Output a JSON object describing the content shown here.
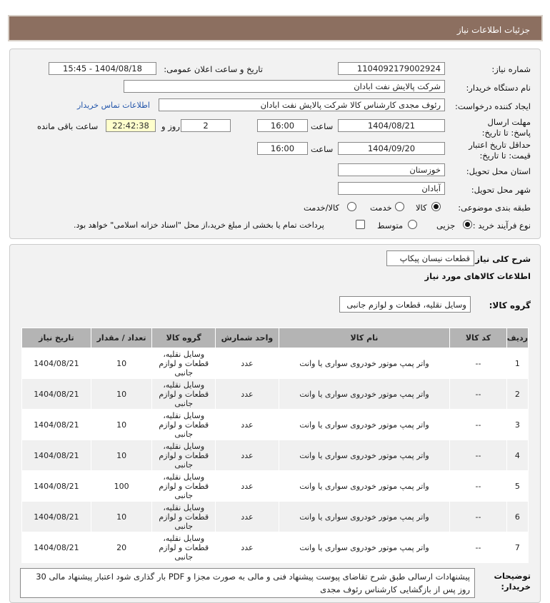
{
  "header": {
    "title": "جزئیات اطلاعات نیاز"
  },
  "form": {
    "need_number_label": "شماره نیاز:",
    "need_number": "1104092179002924",
    "announce_label": "تاریخ و ساعت اعلان عمومی:",
    "announce_value": "1404/08/18 - 15:45",
    "buyer_org_label": "نام دستگاه خریدار:",
    "buyer_org": "شرکت پالایش نفت ابادان",
    "creator_label": "ایجاد کننده درخواست:",
    "creator": "رئوف مجدی کارشناس کالا شرکت پالایش نفت ابادان",
    "contact_link": "اطلاعات تماس خریدار",
    "deadline_label": "مهلت ارسال پاسخ: تا تاریخ:",
    "deadline_date": "1404/08/21",
    "time_label": "ساعت",
    "deadline_time": "16:00",
    "days_value": "2",
    "days_label": "روز و",
    "remaining_time": "22:42:38",
    "remaining_label": "ساعت باقی مانده",
    "validity_label": "حداقل تاریخ اعتبار قیمت: تا تاریخ:",
    "validity_date": "1404/09/20",
    "validity_time": "16:00",
    "province_label": "استان محل تحویل:",
    "province": "خوزستان",
    "city_label": "شهر محل تحویل:",
    "city": "آبادان",
    "category_label": "طبقه بندی موضوعی:",
    "category_options": [
      "کالا",
      "خدمت",
      "کالا/خدمت"
    ],
    "purchase_type_label": "نوع فرآیند خرید :",
    "purchase_options": [
      "جزیی",
      "متوسط"
    ],
    "payment_note": "پرداخت تمام یا بخشی از مبلغ خرید،از محل \"اسناد خزانه اسلامی\" خواهد بود."
  },
  "summary": {
    "general_desc_label": "شرح کلی نیاز:",
    "general_desc": "قطعات نیسان پیکاپ",
    "goods_info_title": "اطلاعات کالاهای مورد نیاز",
    "goods_group_label": "گروه کالا:",
    "goods_group": "وسایل نقلیه، قطعات و لوازم جانبی"
  },
  "table": {
    "headers": [
      "ردیف",
      "کد کالا",
      "نام کالا",
      "واحد شمارش",
      "گروه کالا",
      "تعداد / مقدار",
      "تاریخ نیاز"
    ],
    "rows": [
      {
        "idx": "1",
        "code": "--",
        "name": "واتر پمپ موتور خودروی سواری یا وانت",
        "unit": "عدد",
        "group": "وسایل نقلیه، قطعات و لوازم جانبی",
        "qty": "10",
        "date": "1404/08/21"
      },
      {
        "idx": "2",
        "code": "--",
        "name": "واتر پمپ موتور خودروی سواری یا وانت",
        "unit": "عدد",
        "group": "وسایل نقلیه، قطعات و لوازم جانبی",
        "qty": "10",
        "date": "1404/08/21"
      },
      {
        "idx": "3",
        "code": "--",
        "name": "واتر پمپ موتور خودروی سواری یا وانت",
        "unit": "عدد",
        "group": "وسایل نقلیه، قطعات و لوازم جانبی",
        "qty": "10",
        "date": "1404/08/21"
      },
      {
        "idx": "4",
        "code": "--",
        "name": "واتر پمپ موتور خودروی سواری یا وانت",
        "unit": "عدد",
        "group": "وسایل نقلیه، قطعات و لوازم جانبی",
        "qty": "10",
        "date": "1404/08/21"
      },
      {
        "idx": "5",
        "code": "--",
        "name": "واتر پمپ موتور خودروی سواری یا وانت",
        "unit": "عدد",
        "group": "وسایل نقلیه، قطعات و لوازم جانبی",
        "qty": "100",
        "date": "1404/08/21"
      },
      {
        "idx": "6",
        "code": "--",
        "name": "واتر پمپ موتور خودروی سواری یا وانت",
        "unit": "عدد",
        "group": "وسایل نقلیه، قطعات و لوازم جانبی",
        "qty": "10",
        "date": "1404/08/21"
      },
      {
        "idx": "7",
        "code": "--",
        "name": "واتر پمپ موتور خودروی سواری یا وانت",
        "unit": "عدد",
        "group": "وسایل نقلیه، قطعات و لوازم جانبی",
        "qty": "20",
        "date": "1404/08/21"
      }
    ]
  },
  "buyer_notes": {
    "label": "توضیحات خریدار:",
    "text": "پیشنهادات ارسالی طبق شرح تقاضای پیوست پیشنهاد فنی و مالی به صورت مجزا و PDF بار گذاری شود اعتبار پیشنهاد مالی 30 روز پس از بازگشایی کارشناس رئوف مجدی"
  }
}
